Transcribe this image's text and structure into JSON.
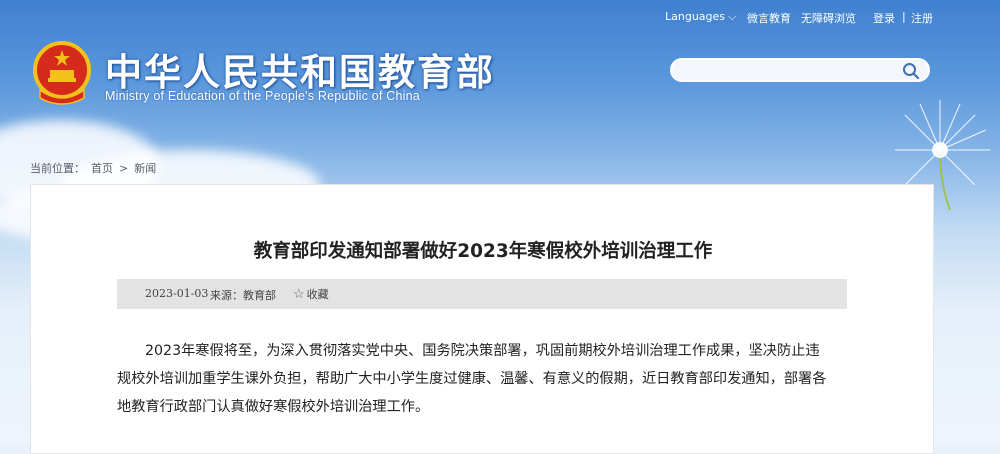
{
  "header": {
    "title_cn": "中华人民共和国教育部",
    "title_en": "Ministry of Education of the People's Republic of China"
  },
  "topnav": {
    "languages": "Languages",
    "weixin": "微言教育",
    "accessible": "无障碍浏览",
    "login": "登录",
    "separator": "|",
    "register": "注册"
  },
  "search": {
    "placeholder": "",
    "icon": "search-icon"
  },
  "breadcrumb": {
    "prefix": "当前位置：",
    "home": "首页",
    "sep": ">",
    "current": "新闻"
  },
  "article": {
    "title": "教育部印发通知部署做好2023年寒假校外培训治理工作",
    "date": "2023-01-03",
    "source": "来源：教育部",
    "favorite": "收藏",
    "paragraph_lines": [
      "2023年寒假将至，为深入贯彻落实党中央、国务院决策部署，巩固前期校外培训治理工作成果，坚决防止违",
      "规校外培训加重学生课外负担，帮助广大中小学生度过健康、温馨、有意义的假期，近日教育部印发通知，部署各",
      "地教育行政部门认真做好寒假校外培训治理工作。"
    ]
  },
  "colors": {
    "accent": "#3f80cf",
    "emblem_red": "#d62a1c",
    "emblem_gold": "#f3c21a"
  }
}
